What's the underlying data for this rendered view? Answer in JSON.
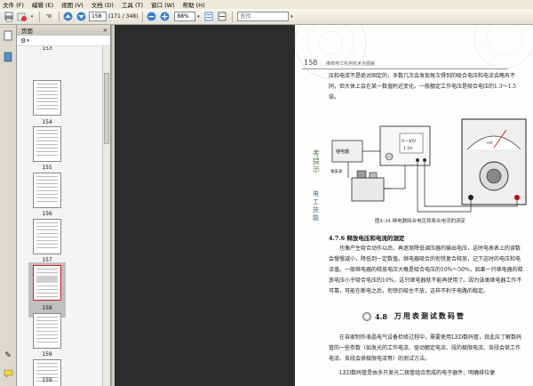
{
  "menu": {
    "file": "文件 (F)",
    "edit": "编辑 (E)",
    "view": "视图 (V)",
    "document": "文档 (D)",
    "tools": "工具 (T)",
    "window": "窗口 (W)",
    "help": "帮助 (H)"
  },
  "toolbar": {
    "page_current": "158",
    "page_range": "(171 / 348)",
    "zoom": "88%",
    "search_placeholder": "查找"
  },
  "panel": {
    "title": "页面",
    "close": "×"
  },
  "thumbs": {
    "t153": "153",
    "t154": "154",
    "t155": "155",
    "t156": "156",
    "t157": "157",
    "t158": "158",
    "t159": "159",
    "t160": "159"
  },
  "doc": {
    "page_number": "158",
    "running_head": "维修电工实用技术全图解",
    "para1": "压和电流不是绝对固定的，多数几次会发现每次得到的吸合电压和电流会略有不同，但大体上会在某一数值附近变化。一般额定工作电压是吸合电压的1.3～1.5倍。",
    "fig_caption": "图4-34  继电器吸合电压和吸合电流的测定",
    "sec476_title": "4.7.6  释放电压和电流的测定",
    "para2": "也像产生吸合动作以后，再逐渐降低调压器的输出电压，这时电表表上的读数会慢慢减小，降低到一定数值，继电器吸合的衔铁复合释放，记下这时的电压和电流值。一般继电器的释放电压大概是吸合电压的10%～50%，如果一只继电器的释放电压小于吸合电压的10%，这只继电器就不能再使用了。因为该类继电器工作不可靠，可能在断电之后，衔铁仍吸住不放，这样不利于电路的稳定。",
    "sec48_num": "4.8",
    "sec48_title": "万用表测试数码管",
    "para3": "在自家制作液晶电气设备检修过程中，需要使用LED数码管，现此应了解数码管的一些参数（如发光的工作电流、驱动额定电流、段的极限电流、各段会供工作电流、各段会供极限电流等）的测试方法。",
    "para4": "LED数码管是由多只发光二极管组合而成的电子器件，明确排位便",
    "fig_label_box": "继电器",
    "fig_label_meter": "毫安表",
    "fig_label_psu_top": "0～30V",
    "fig_label_psu_bot": "1.5A",
    "fig_label_meter2": "mA",
    "side_mark_a": "考提示",
    "side_mark_b": "电工技能"
  }
}
